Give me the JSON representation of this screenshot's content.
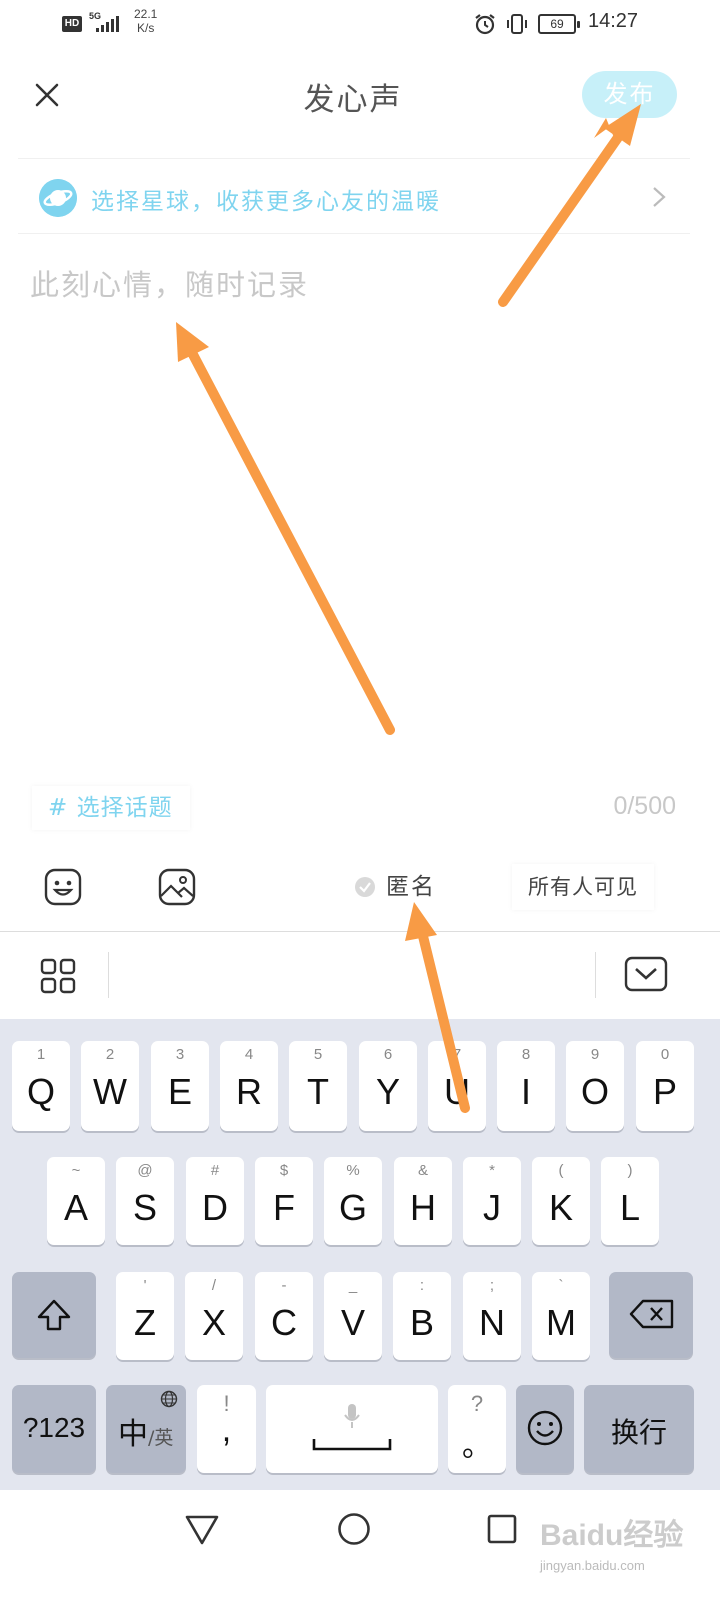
{
  "status_bar": {
    "hd": "HD",
    "network": "5G",
    "speed_value": "22.1",
    "speed_unit": "K/s",
    "battery": "69",
    "time": "14:27"
  },
  "header": {
    "title": "发心声",
    "publish_label": "发布"
  },
  "planet": {
    "text": "选择星球，收获更多心友的温暖"
  },
  "editor": {
    "placeholder": "此刻心情，随时记录",
    "topic_label": "# 选择话题",
    "char_count": "0/500"
  },
  "toolbar": {
    "anonymous_label": "匿名",
    "visibility_label": "所有人可见"
  },
  "keyboard": {
    "row1": [
      {
        "main": "Q",
        "sub": "1"
      },
      {
        "main": "W",
        "sub": "2"
      },
      {
        "main": "E",
        "sub": "3"
      },
      {
        "main": "R",
        "sub": "4"
      },
      {
        "main": "T",
        "sub": "5"
      },
      {
        "main": "Y",
        "sub": "6"
      },
      {
        "main": "U",
        "sub": "7"
      },
      {
        "main": "I",
        "sub": "8"
      },
      {
        "main": "O",
        "sub": "9"
      },
      {
        "main": "P",
        "sub": "0"
      }
    ],
    "row2": [
      {
        "main": "A",
        "sub": "~"
      },
      {
        "main": "S",
        "sub": "@"
      },
      {
        "main": "D",
        "sub": "#"
      },
      {
        "main": "F",
        "sub": "$"
      },
      {
        "main": "G",
        "sub": "%"
      },
      {
        "main": "H",
        "sub": "&"
      },
      {
        "main": "J",
        "sub": "*"
      },
      {
        "main": "K",
        "sub": "("
      },
      {
        "main": "L",
        "sub": ")"
      }
    ],
    "row3": [
      {
        "main": "Z",
        "sub": "'"
      },
      {
        "main": "X",
        "sub": "/"
      },
      {
        "main": "C",
        "sub": "-"
      },
      {
        "main": "V",
        "sub": "_"
      },
      {
        "main": "B",
        "sub": ":"
      },
      {
        "main": "N",
        "sub": ";"
      },
      {
        "main": "M",
        "sub": "`"
      }
    ],
    "numbers_label": "?123",
    "lang_main": "中",
    "lang_sub": "/英",
    "comma_main": ",",
    "comma_sub": "!",
    "period_main": "。",
    "period_sub": "?",
    "enter_label": "换行"
  },
  "watermark": {
    "text": "Baidu经验",
    "sub": "jingyan.baidu.com"
  },
  "colors": {
    "accent": "#7fd4ef",
    "publish_bg": "#c7f0f9",
    "annotation_arrow": "#f89b45",
    "keyboard_bg": "#e3e6ef"
  }
}
